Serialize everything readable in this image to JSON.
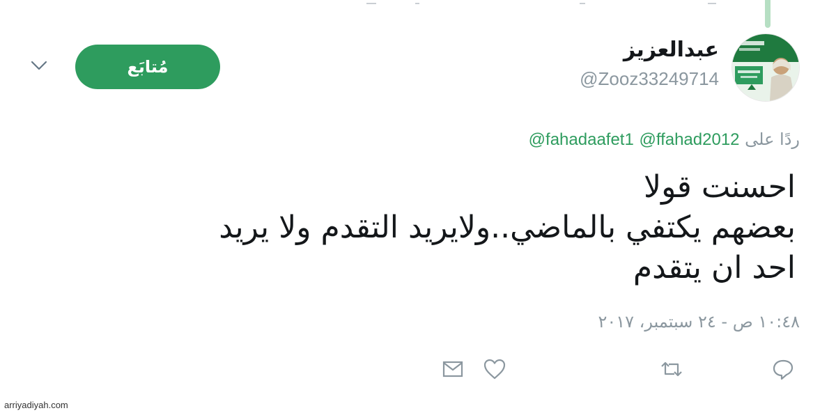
{
  "colors": {
    "accent": "#2e9c5e",
    "muted": "#8b979f",
    "text": "#14171a"
  },
  "author": {
    "display_name": "عبدالعزيز",
    "handle": "@Zooz33249714",
    "follow_label": "مُتابَع"
  },
  "reply": {
    "prefix": "ردًا على",
    "mentions": [
      "@ffahad2012",
      "@fahadaafet1"
    ]
  },
  "tweet": {
    "lines": [
      "احسنت قولا",
      "بعضهم يكتفي بالماضي..ولايريد التقدم ولا يريد",
      "احد ان يتقدم"
    ],
    "timestamp": "١٠:٤٨ ص - ٢٤ سبتمبر، ٢٠١٧"
  },
  "actions": [
    "reply-icon",
    "retweet-icon",
    "like-icon",
    "message-icon"
  ],
  "watermark": "arriyadiyah.com"
}
